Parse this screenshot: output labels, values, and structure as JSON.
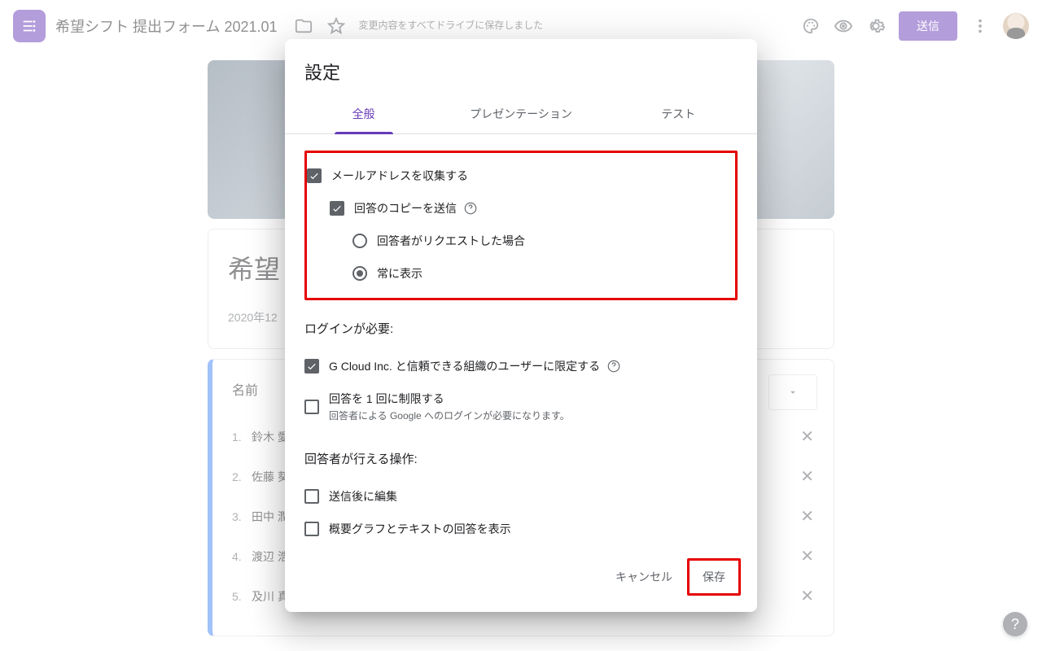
{
  "header": {
    "title": "希望シフト 提出フォーム 2021.01",
    "save_status": "変更内容をすべてドライブに保存しました",
    "send_label": "送信"
  },
  "form": {
    "title_prefix": "希望",
    "date_prefix": "2020年12",
    "question_title": "名前",
    "options": [
      "鈴木 愛",
      "佐藤 葵",
      "田中 潤",
      "渡辺 浩",
      "及川 真子"
    ]
  },
  "dialog": {
    "title": "設定",
    "tabs": {
      "general": "全般",
      "presentation": "プレゼンテーション",
      "test": "テスト"
    },
    "collect_email": "メールアドレスを収集する",
    "send_copy": "回答のコピーを送信",
    "on_request": "回答者がリクエストした場合",
    "always": "常に表示",
    "login_section": "ログインが必要:",
    "restrict_org": "G Cloud Inc. と信頼できる組織のユーザーに限定する",
    "limit_one": "回答を 1 回に制限する",
    "limit_one_sub": "回答者による Google へのログインが必要になります。",
    "respondent_section": "回答者が行える操作:",
    "edit_after": "送信後に編集",
    "show_summary": "概要グラフとテキストの回答を表示",
    "cancel": "キャンセル",
    "save": "保存"
  }
}
